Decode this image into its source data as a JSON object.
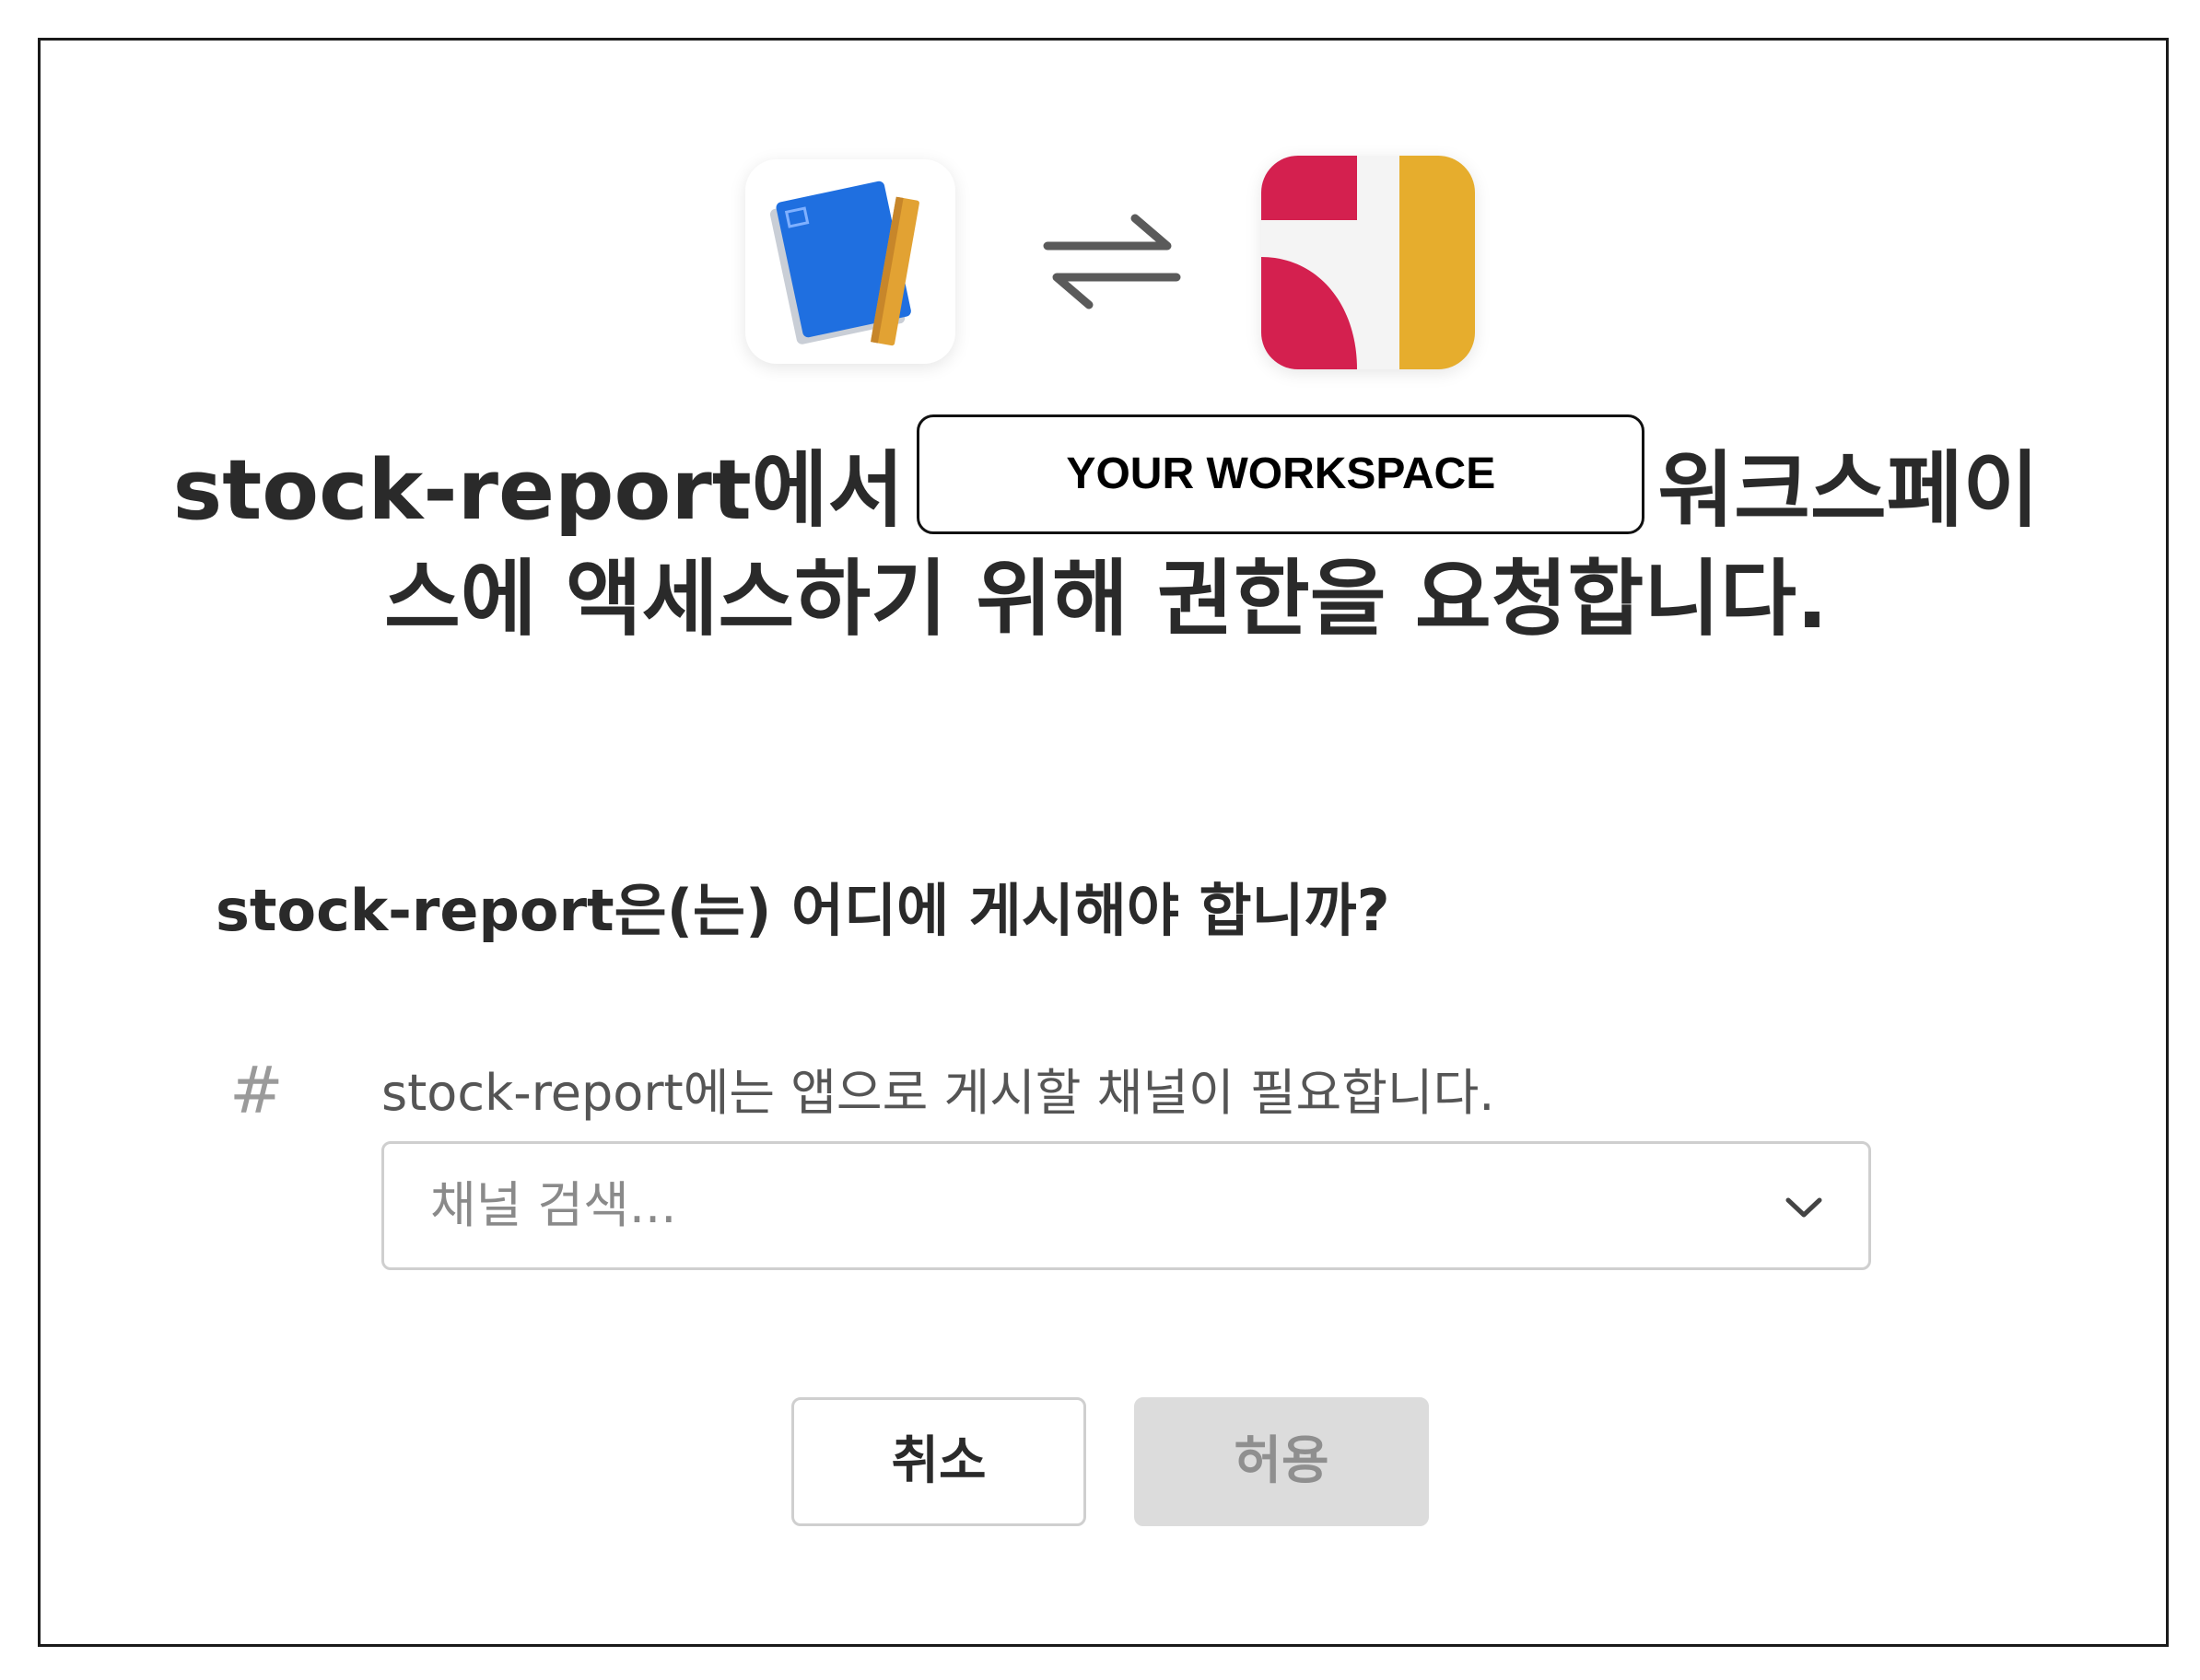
{
  "header": {
    "app_icon": "notebook-ruler-icon",
    "swap_icon": "swap-arrows-icon",
    "workspace_icon": "workspace-logo-icon",
    "workspace_colors": {
      "red": "#d4204f",
      "gold": "#e6ad2d"
    }
  },
  "title": {
    "prefix": "stock-report에서",
    "workspace_placeholder": "YOUR WORKSPACE",
    "suffix_line1": "워크스페이",
    "line2": "스에 액세스하기 위해 권한을 요청합니다."
  },
  "channel_section": {
    "question": "stock-report은(는) 어디에 게시해야 합니까?",
    "hash_icon": "#",
    "hint": "stock-report에는 앱으로 게시할 채널이 필요합니다.",
    "search_placeholder": "채널 검색...",
    "dropdown_icon": "chevron-down-icon"
  },
  "actions": {
    "cancel_label": "취소",
    "allow_label": "허용"
  }
}
